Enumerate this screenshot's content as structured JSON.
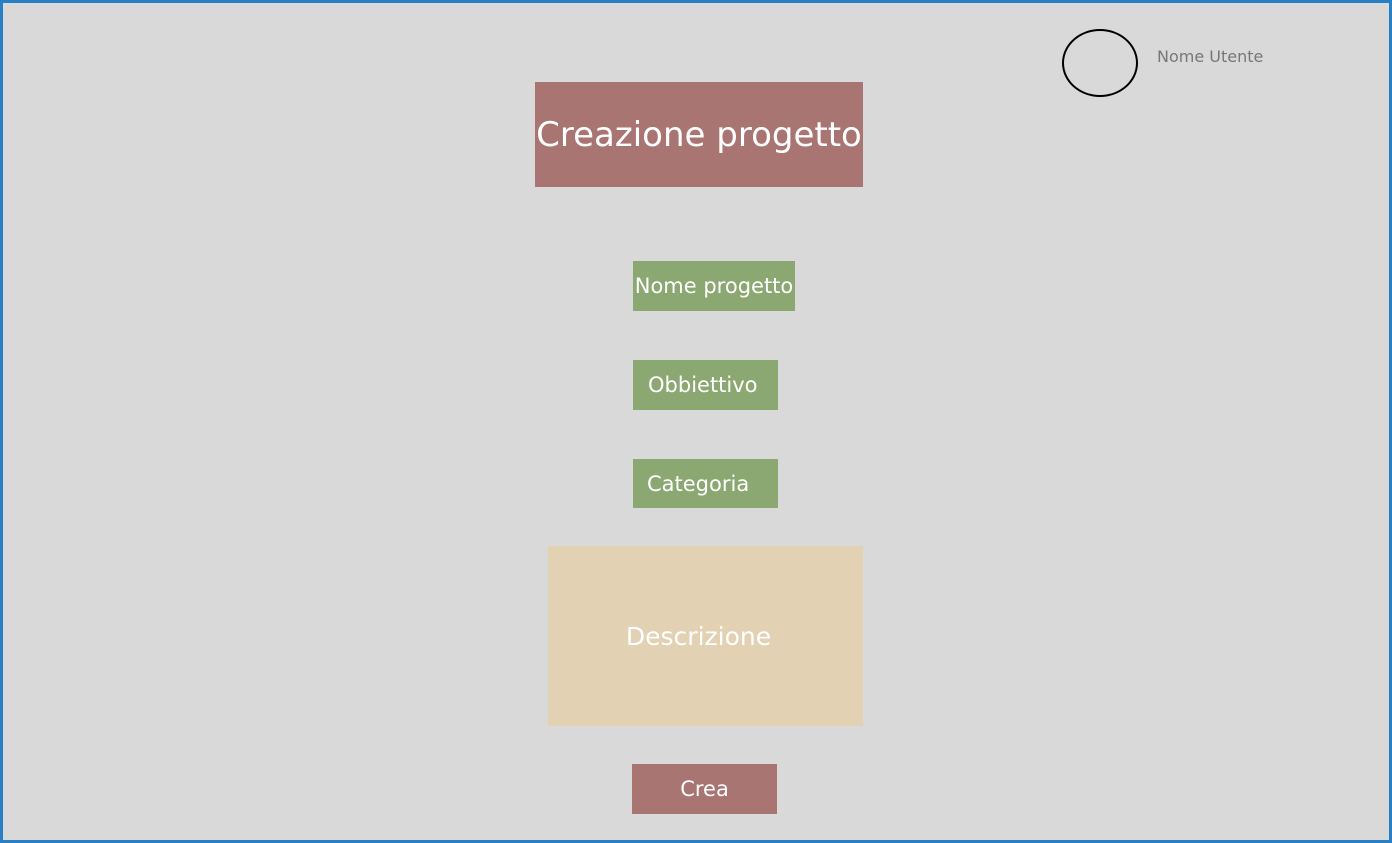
{
  "header": {
    "username": "Nome Utente"
  },
  "title": "Creazione progetto",
  "form": {
    "name_label": "Nome progetto",
    "goal_label": "Obbiettivo",
    "category_label": "Categoria",
    "description_label": "Descrizione",
    "submit_label": "Crea"
  },
  "colors": {
    "background": "#d9d9d9",
    "frame_border": "#2a7fc4",
    "title_box": "#a87572",
    "field": "#8ca872",
    "description_box": "#e3d1b3",
    "submit_button": "#a87572",
    "text_light": "#ffffff",
    "username_text": "#777777"
  }
}
